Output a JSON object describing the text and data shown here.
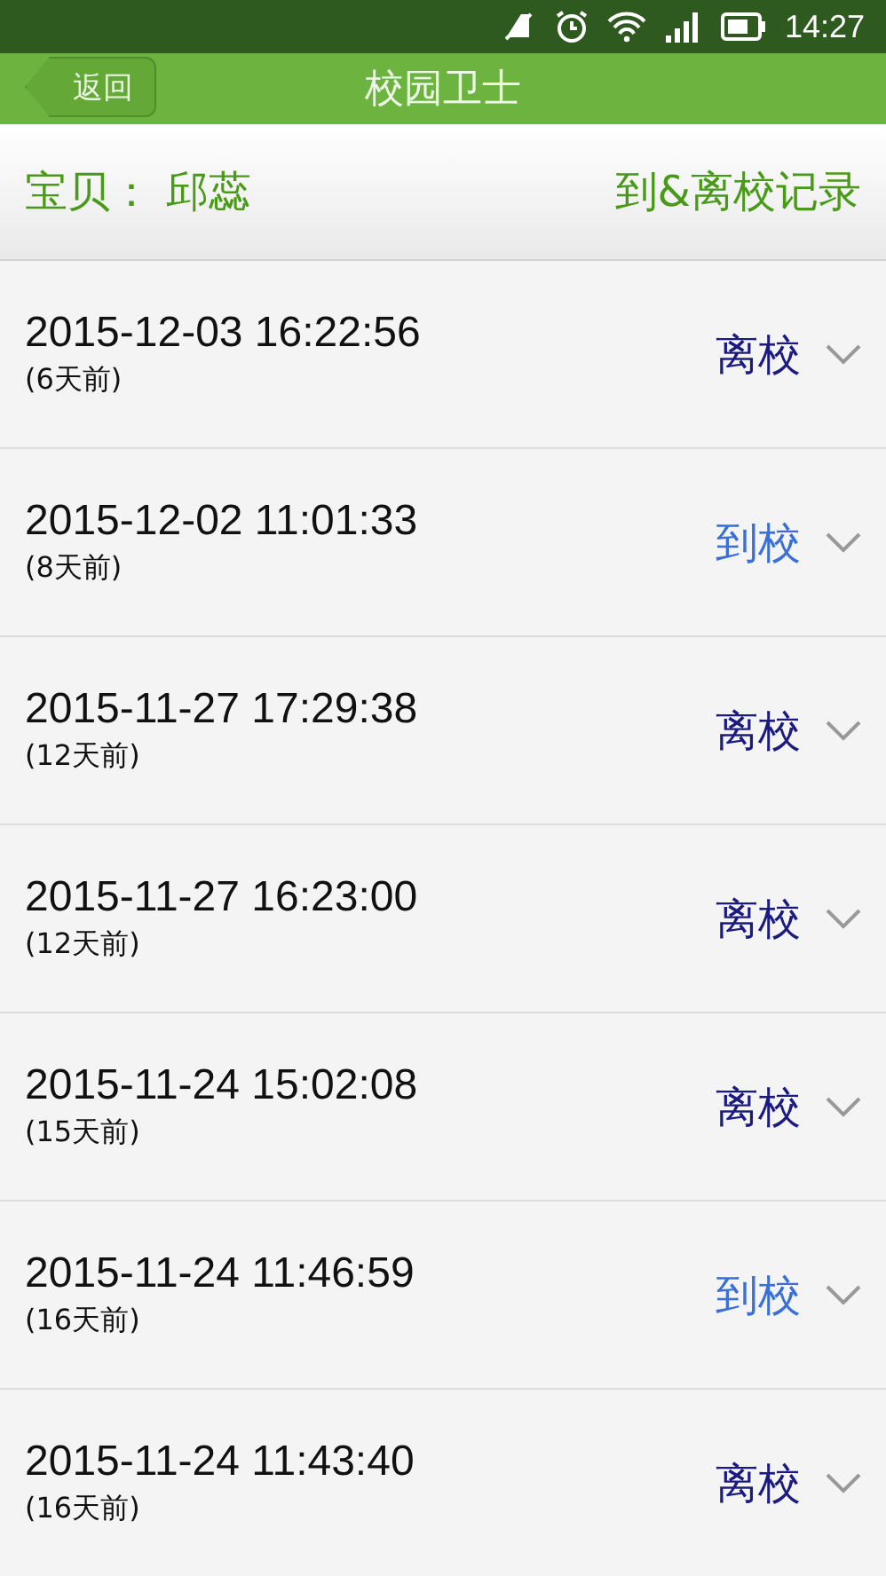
{
  "status_bar": {
    "time": "14:27"
  },
  "header": {
    "back": "返回",
    "title": "校园卫士"
  },
  "subheader": {
    "child": "宝贝： 邱蕊",
    "heading": "到&离校记录"
  },
  "records": [
    {
      "time": "2015-12-03 16:22:56",
      "ago": "(6天前)",
      "kind": "leave",
      "status": "离校"
    },
    {
      "time": "2015-12-02 11:01:33",
      "ago": "(8天前)",
      "kind": "arrive",
      "status": "到校"
    },
    {
      "time": "2015-11-27 17:29:38",
      "ago": "(12天前)",
      "kind": "leave",
      "status": "离校"
    },
    {
      "time": "2015-11-27 16:23:00",
      "ago": "(12天前)",
      "kind": "leave",
      "status": "离校"
    },
    {
      "time": "2015-11-24 15:02:08",
      "ago": "(15天前)",
      "kind": "leave",
      "status": "离校"
    },
    {
      "time": "2015-11-24 11:46:59",
      "ago": "(16天前)",
      "kind": "arrive",
      "status": "到校"
    },
    {
      "time": "2015-11-24 11:43:40",
      "ago": "(16天前)",
      "kind": "leave",
      "status": "离校"
    }
  ]
}
